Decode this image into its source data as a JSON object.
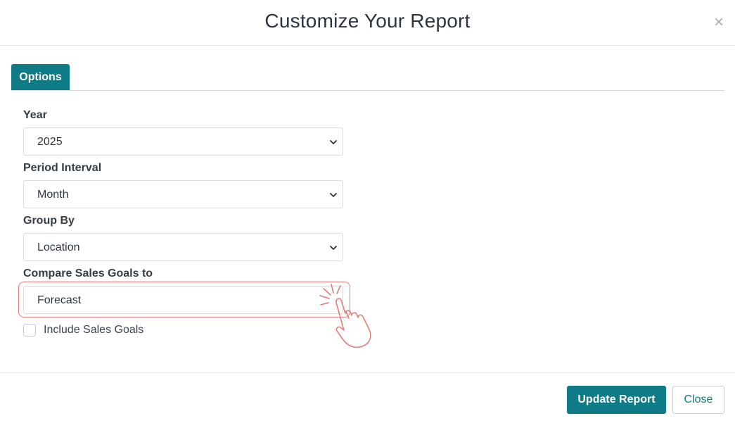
{
  "modal": {
    "title": "Customize Your Report",
    "close_symbol": "×"
  },
  "tabs": [
    {
      "label": "Options",
      "active": true
    }
  ],
  "fields": {
    "year": {
      "label": "Year",
      "value": "2025"
    },
    "period_interval": {
      "label": "Period Interval",
      "value": "Month"
    },
    "group_by": {
      "label": "Group By",
      "value": "Location"
    },
    "compare_sales_goals": {
      "label": "Compare Sales Goals to",
      "value": "Forecast"
    }
  },
  "include_sales_goals": {
    "label": "Include Sales Goals",
    "checked": false
  },
  "footer": {
    "update_label": "Update Report",
    "close_label": "Close"
  },
  "colors": {
    "accent": "#0f7b87",
    "highlight": "#e07d7a"
  },
  "icons": {
    "close": "close-icon",
    "chevron": "chevron-down-icon",
    "pointer": "pointing-hand-icon"
  }
}
